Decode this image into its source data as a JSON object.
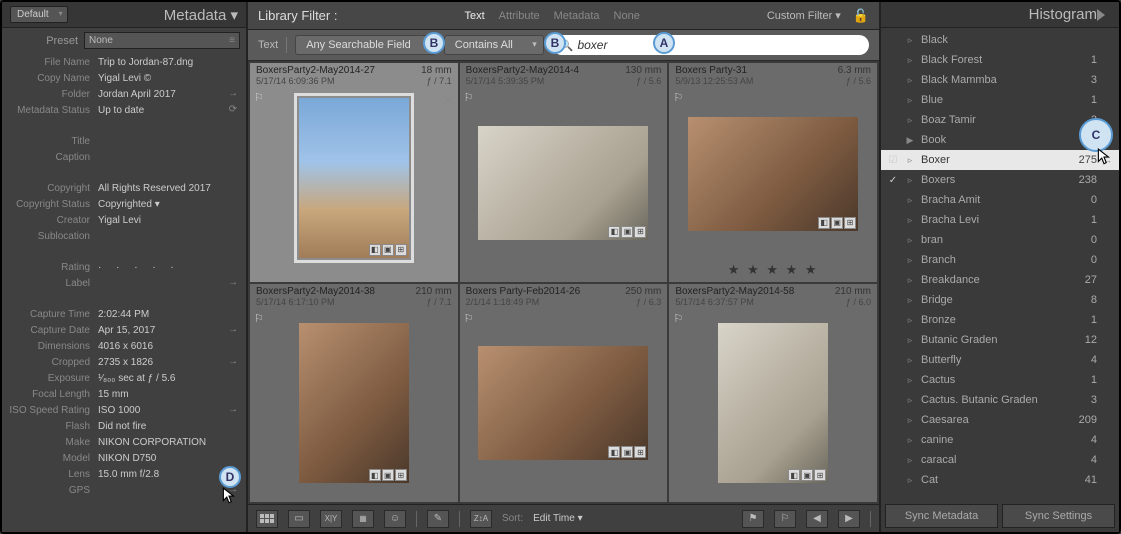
{
  "left": {
    "default_sel": "Default",
    "title": "Metadata ▾",
    "preset_lbl": "Preset",
    "preset_val": "None",
    "rows": [
      {
        "k": "File Name",
        "v": "Trip to Jordan-87.dng",
        "go": ""
      },
      {
        "k": "Copy Name",
        "v": "Yigal Levi ©",
        "go": ""
      },
      {
        "k": "Folder",
        "v": "Jordan April 2017",
        "go": "→"
      },
      {
        "k": "Metadata Status",
        "v": "Up to date",
        "go": "⟳"
      },
      {
        "k": "",
        "v": "",
        "go": "",
        "gap": true
      },
      {
        "k": "Title",
        "v": "",
        "go": ""
      },
      {
        "k": "Caption",
        "v": "",
        "go": ""
      },
      {
        "k": "",
        "v": "",
        "go": "",
        "gap": true
      },
      {
        "k": "Copyright",
        "v": "All Rights Reserved 2017",
        "go": ""
      },
      {
        "k": "Copyright Status",
        "v": "Copyrighted  ▾",
        "go": ""
      },
      {
        "k": "Creator",
        "v": "Yigal Levi",
        "go": ""
      },
      {
        "k": "Sublocation",
        "v": "",
        "go": ""
      },
      {
        "k": "",
        "v": "",
        "go": "",
        "gap": true
      },
      {
        "k": "Rating",
        "v": "·  ·  ·  ·  ·",
        "go": "",
        "dots": true
      },
      {
        "k": "Label",
        "v": "",
        "go": "→"
      },
      {
        "k": "",
        "v": "",
        "go": "",
        "gap": true
      },
      {
        "k": "Capture Time",
        "v": "2:02:44 PM",
        "go": ""
      },
      {
        "k": "Capture Date",
        "v": "Apr 15, 2017",
        "go": "→"
      },
      {
        "k": "Dimensions",
        "v": "4016 x 6016",
        "go": ""
      },
      {
        "k": "Cropped",
        "v": "2735 x 1826",
        "go": "→"
      },
      {
        "k": "Exposure",
        "v": "¹⁄₈₀₀ sec at ƒ / 5.6",
        "go": ""
      },
      {
        "k": "Focal Length",
        "v": "15 mm",
        "go": ""
      },
      {
        "k": "ISO Speed Rating",
        "v": "ISO 1000",
        "go": "→"
      },
      {
        "k": "Flash",
        "v": "Did not fire",
        "go": ""
      },
      {
        "k": "Make",
        "v": "NIKON CORPORATION",
        "go": ""
      },
      {
        "k": "Model",
        "v": "NIKON D750",
        "go": ""
      },
      {
        "k": "Lens",
        "v": "15.0 mm f/2.8",
        "go": "→"
      },
      {
        "k": "GPS",
        "v": "",
        "go": "→"
      }
    ]
  },
  "filter": {
    "bar_title": "Library Filter :",
    "tabs": [
      "Text",
      "Attribute",
      "Metadata",
      "None"
    ],
    "custom": "Custom Filter ▾",
    "text_lbl": "Text",
    "field": "Any Searchable Field",
    "contains": "Contains All",
    "search_icon": "🔍",
    "query": "boxer"
  },
  "grid": [
    {
      "name": "BoxersParty2-May2014-27",
      "focal": "18 mm",
      "date": "5/17/14 6:09:36 PM",
      "ap": "ƒ / 7.1",
      "sel": true,
      "thumb": "sky",
      "ratio": "portrait",
      "dots": true
    },
    {
      "name": "BoxersParty2-May2014-4",
      "focal": "130 mm",
      "date": "5/17/14 5:39:35 PM",
      "ap": "ƒ / 5.6",
      "thumb": "white",
      "ratio": "land"
    },
    {
      "name": "Boxers Party-31",
      "focal": "6.3 mm",
      "date": "5/9/13 12:25:53 AM",
      "ap": "ƒ / 5.6",
      "thumb": "brown",
      "ratio": "land",
      "stars": "★ ★ ★ ★ ★"
    },
    {
      "name": "BoxersParty2-May2014-38",
      "focal": "210 mm",
      "date": "5/17/14 6:17:10 PM",
      "ap": "ƒ / 7.1",
      "thumb": "brown",
      "ratio": "portrait"
    },
    {
      "name": "Boxers Party-Feb2014-26",
      "focal": "250 mm",
      "date": "2/1/14 1:18:49 PM",
      "ap": "ƒ / 6.3",
      "thumb": "brown",
      "ratio": "land"
    },
    {
      "name": "BoxersParty2-May2014-58",
      "focal": "210 mm",
      "date": "5/17/14 6:37:57 PM",
      "ap": "ƒ / 6.0",
      "thumb": "white",
      "ratio": "portrait"
    }
  ],
  "sort": {
    "label": "Sort:",
    "value": "Edit Time ▾"
  },
  "right": {
    "title": "Histogram",
    "keywords": [
      {
        "n": "Black",
        "c": ""
      },
      {
        "n": "Black Forest",
        "c": "1"
      },
      {
        "n": "Black Mammba",
        "c": "3"
      },
      {
        "n": "Blue",
        "c": "1"
      },
      {
        "n": "Boaz Tamir",
        "c": "3"
      },
      {
        "n": "Book",
        "c": "",
        "disc": "▶"
      },
      {
        "n": "Boxer",
        "c": "275",
        "sel": true,
        "chk": "☑"
      },
      {
        "n": "Boxers",
        "c": "238",
        "chk": "✓"
      },
      {
        "n": "Bracha Amit",
        "c": "0"
      },
      {
        "n": "Bracha Levi",
        "c": "1"
      },
      {
        "n": "bran",
        "c": "0"
      },
      {
        "n": "Branch",
        "c": "0"
      },
      {
        "n": "Breakdance",
        "c": "27"
      },
      {
        "n": "Bridge",
        "c": "8"
      },
      {
        "n": "Bronze",
        "c": "1"
      },
      {
        "n": "Butanic Graden",
        "c": "12"
      },
      {
        "n": "Butterfly",
        "c": "4"
      },
      {
        "n": "Cactus",
        "c": "1"
      },
      {
        "n": "Cactus. Butanic Graden",
        "c": "3"
      },
      {
        "n": "Caesarea",
        "c": "209"
      },
      {
        "n": "canine",
        "c": "4"
      },
      {
        "n": "caracal",
        "c": "4"
      },
      {
        "n": "Cat",
        "c": "41"
      }
    ],
    "sync_meta": "Sync Metadata",
    "sync_set": "Sync Settings"
  },
  "callouts": {
    "A": "A",
    "B": "B",
    "C": "C",
    "D": "D"
  }
}
